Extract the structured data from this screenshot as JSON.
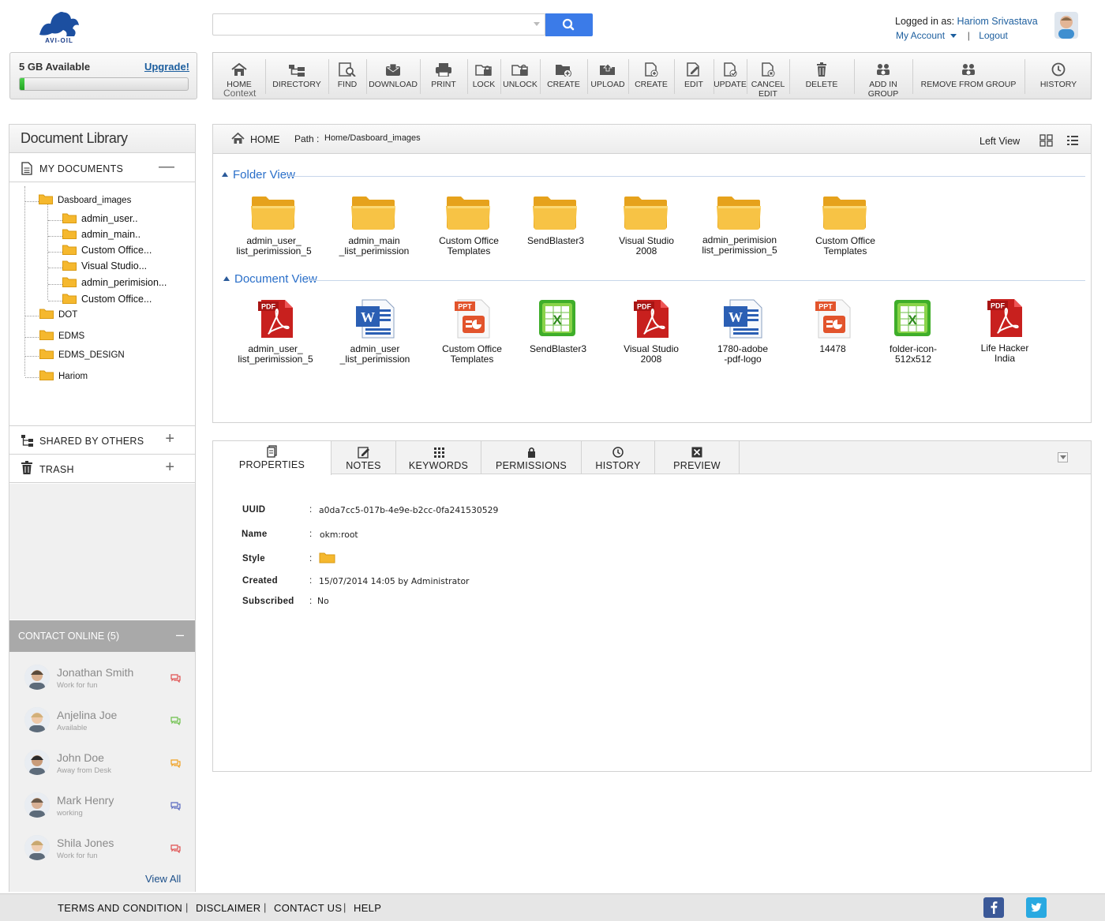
{
  "brand": {
    "logo_text": "AVI-OIL"
  },
  "search": {
    "placeholder": "",
    "value": ""
  },
  "user": {
    "logged_label": "Logged in as:",
    "name": "Hariom Srivastava",
    "account_link": "My Account",
    "sep": "|",
    "logout": "Logout"
  },
  "storage": {
    "available": "5 GB Available",
    "upgrade": "Upgrade!",
    "used_fraction": 0.03
  },
  "toolbar": {
    "items": [
      "HOME",
      "DIRECTORY",
      "FIND",
      "DOWNLOAD",
      "PRINT",
      "LOCK",
      "UNLOCK",
      "CREATE",
      "UPLOAD",
      "CREATE",
      "EDIT",
      "UPDATE",
      "CANCEL EDIT",
      "DELETE",
      "ADD IN GROUP",
      "REMOVE FROM GROUP",
      "HISTORY"
    ],
    "context_label": "Context"
  },
  "left": {
    "title": "Document Library",
    "my_documents": "MY DOCUMENTS",
    "tree": [
      "Dasboard_images",
      "admin_user..",
      "admin_main..",
      "Custom Office...",
      "Visual Studio...",
      "admin_perimision...",
      "Custom Office...",
      "DOT",
      "EDMS",
      "EDMS_DESIGN",
      "Hariom"
    ],
    "shared": "SHARED BY OTHERS",
    "trash": "TRASH",
    "contacts_header": "CONTACT ONLINE (5)",
    "contacts": [
      {
        "name": "Jonathan Smith",
        "status": "Work for fun",
        "chat_color": "#e05050"
      },
      {
        "name": "Anjelina Joe",
        "status": "Available",
        "chat_color": "#6cc04a"
      },
      {
        "name": "John Doe",
        "status": "Away from Desk",
        "chat_color": "#f0a020"
      },
      {
        "name": "Mark Henry",
        "status": "working",
        "chat_color": "#5a6ac0"
      },
      {
        "name": "Shila Jones",
        "status": "Work for fun",
        "chat_color": "#e05050"
      }
    ],
    "view_all": "View All"
  },
  "main": {
    "home": "HOME",
    "path_label": "Path :",
    "path": "Home/Dasboard_images",
    "left_view": "Left View",
    "folder_view": "Folder View",
    "document_view": "Document View",
    "folders": [
      [
        "admin_user_",
        "list_perimission_5"
      ],
      [
        "admin_main",
        "_list_perimission"
      ],
      [
        "Custom Office",
        "Templates"
      ],
      [
        "SendBlaster3",
        ""
      ],
      [
        "Visual Studio",
        "2008"
      ],
      [
        "admin_perimision",
        "list_perimission_5"
      ],
      [
        "Custom Office",
        "Templates"
      ]
    ],
    "documents": [
      {
        "type": "pdf",
        "lines": [
          "admin_user_",
          "list_perimission_5"
        ]
      },
      {
        "type": "word",
        "lines": [
          "admin_user",
          "_list_perimission"
        ]
      },
      {
        "type": "ppt",
        "lines": [
          "Custom Office",
          "Templates"
        ]
      },
      {
        "type": "excel",
        "lines": [
          "SendBlaster3",
          ""
        ]
      },
      {
        "type": "pdf",
        "lines": [
          "Visual Studio",
          "2008"
        ]
      },
      {
        "type": "word",
        "lines": [
          "1780-adobe",
          "-pdf-logo"
        ]
      },
      {
        "type": "ppt",
        "lines": [
          "14478",
          ""
        ]
      },
      {
        "type": "excel",
        "lines": [
          "folder-icon-",
          "512x512"
        ]
      },
      {
        "type": "pdf",
        "lines": [
          "Life Hacker",
          "India"
        ]
      }
    ]
  },
  "tabs": [
    "PROPERTIES",
    "NOTES",
    "KEYWORDS",
    "PERMISSIONS",
    "HISTORY",
    "PREVIEW"
  ],
  "properties": {
    "uuid_label": "UUID",
    "uuid": "a0da7cc5-017b-4e9e-b2cc-0fa241530529",
    "name_label": "Name",
    "name": "okm:root",
    "style_label": "Style",
    "created_label": "Created",
    "created": "15/07/2014  14:05 by Administrator",
    "subscribed_label": "Subscribed",
    "subscribed": "No",
    "colon": ":"
  },
  "footer": {
    "links": [
      "TERMS AND CONDITION",
      "DISCLAIMER",
      "CONTACT US",
      "HELP"
    ],
    "sep": "|"
  },
  "colors": {
    "accent": "#3b7be8",
    "folder": "#f5b82e",
    "pdf": "#c8201e",
    "word": "#2b5fb4",
    "excel": "#3fae2a",
    "ppt": "#e2542c"
  }
}
